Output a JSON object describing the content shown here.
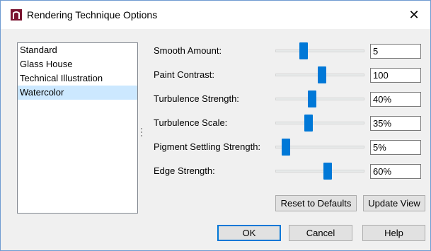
{
  "window": {
    "title": "Rendering Technique Options",
    "close_glyph": "✕",
    "icon": "app-icon"
  },
  "techniques": {
    "items": [
      {
        "label": "Standard",
        "selected": false
      },
      {
        "label": "Glass House",
        "selected": false
      },
      {
        "label": "Technical Illustration",
        "selected": false
      },
      {
        "label": "Watercolor",
        "selected": true
      }
    ]
  },
  "settings": [
    {
      "label": "Smooth Amount:",
      "value": "5",
      "slider_fraction": 0.28
    },
    {
      "label": "Paint Contrast:",
      "value": "100",
      "slider_fraction": 0.53
    },
    {
      "label": "Turbulence Strength:",
      "value": "40%",
      "slider_fraction": 0.4
    },
    {
      "label": "Turbulence Scale:",
      "value": "35%",
      "slider_fraction": 0.35
    },
    {
      "label": "Pigment Settling Strength:",
      "value": "5%",
      "slider_fraction": 0.05
    },
    {
      "label": "Edge Strength:",
      "value": "60%",
      "slider_fraction": 0.6
    }
  ],
  "buttons": {
    "reset": "Reset to Defaults",
    "update": "Update View",
    "ok": "OK",
    "cancel": "Cancel",
    "help": "Help"
  },
  "colors": {
    "accent": "#0078d7",
    "selection": "#cce8ff",
    "icon": "#7a1430"
  }
}
